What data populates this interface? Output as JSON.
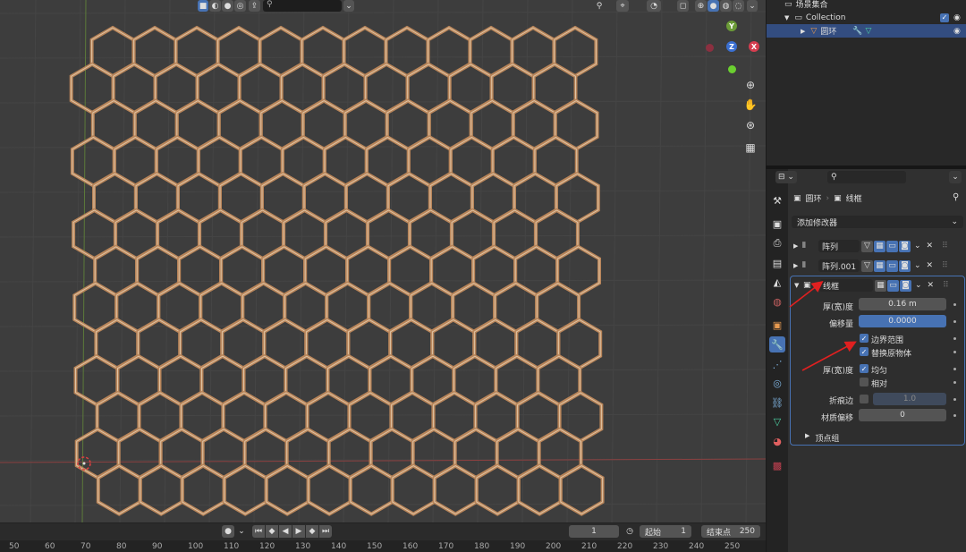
{
  "viewport": {
    "header_search": "",
    "hex_color": "#b8855a",
    "nav_icons": [
      "zoom-icon",
      "hand-icon",
      "camera-icon",
      "grid-icon"
    ],
    "gizmo": {
      "y": "Y",
      "z": "Z",
      "x": "X"
    }
  },
  "timeline": {
    "current_frame": "1",
    "start_label": "起始",
    "start_value": "1",
    "end_label": "结束点",
    "end_value": "250",
    "ruler": [
      "50",
      "60",
      "70",
      "80",
      "90",
      "100",
      "110",
      "120",
      "130",
      "140",
      "150",
      "160",
      "170",
      "180",
      "190",
      "200",
      "210",
      "220",
      "230",
      "240",
      "250"
    ]
  },
  "outliner": {
    "scene_collection": "场景集合",
    "collection": "Collection",
    "object": "圆环"
  },
  "properties": {
    "breadcrumb_object": "圆环",
    "breadcrumb_modifier": "线框",
    "add_modifier": "添加修改器",
    "modifiers": [
      {
        "name": "阵列"
      },
      {
        "name": "阵列.001"
      },
      {
        "name": "线框"
      }
    ],
    "wireframe": {
      "thickness_label": "厚(宽)度",
      "thickness_value": "0.16 m",
      "offset_label": "偏移量",
      "offset_value": "0.0000",
      "boundary_label": "边界范围",
      "replace_label": "替换原物体",
      "thickness2_label": "厚(宽)度",
      "even_label": "均匀",
      "relative_label": "相对",
      "crease_label": "折痕边",
      "crease_value": "1.0",
      "material_label": "材质偏移",
      "material_value": "0",
      "vertex_group_label": "顶点组"
    }
  }
}
